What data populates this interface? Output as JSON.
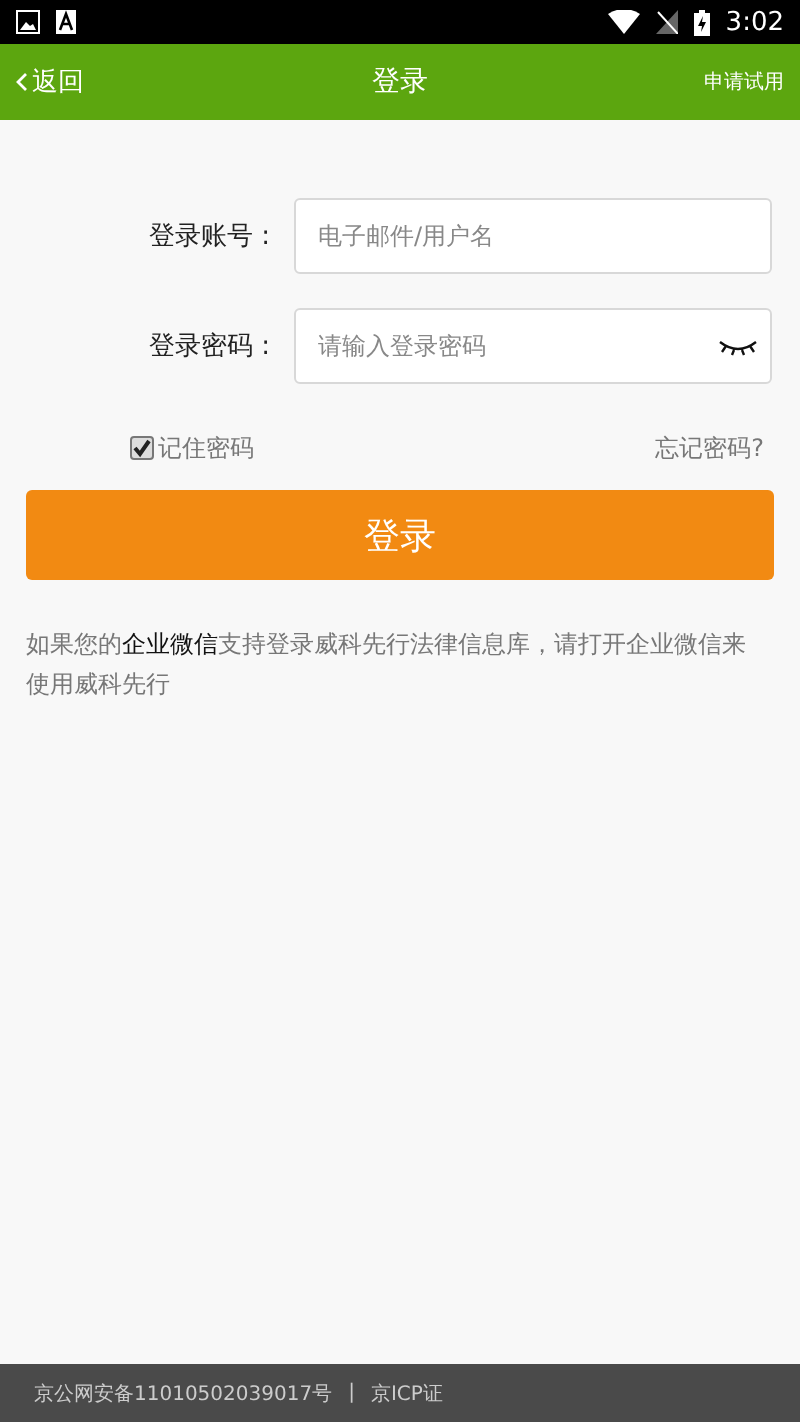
{
  "status_bar": {
    "time": "3:02"
  },
  "header": {
    "back": "返回",
    "title": "登录",
    "action": "申请试用"
  },
  "form": {
    "fields": [
      {
        "label": "登录账号 :",
        "placeholder": "电子邮件/用户名",
        "kind": "text"
      },
      {
        "label": "登录密码 :",
        "placeholder": "请输入登录密码",
        "kind": "password"
      }
    ],
    "remember": {
      "label": "记住密码",
      "checked": true
    },
    "forgot": "忘记密码?",
    "submit": "登录"
  },
  "notice": "如果您的**企业微信**支持登录威科先行法律信息库，请打开企业微信来使用威科先行",
  "footer": {
    "texts": [
      "京公网安备11010502039017号",
      "京ICP证"
    ],
    "separator": "|"
  }
}
